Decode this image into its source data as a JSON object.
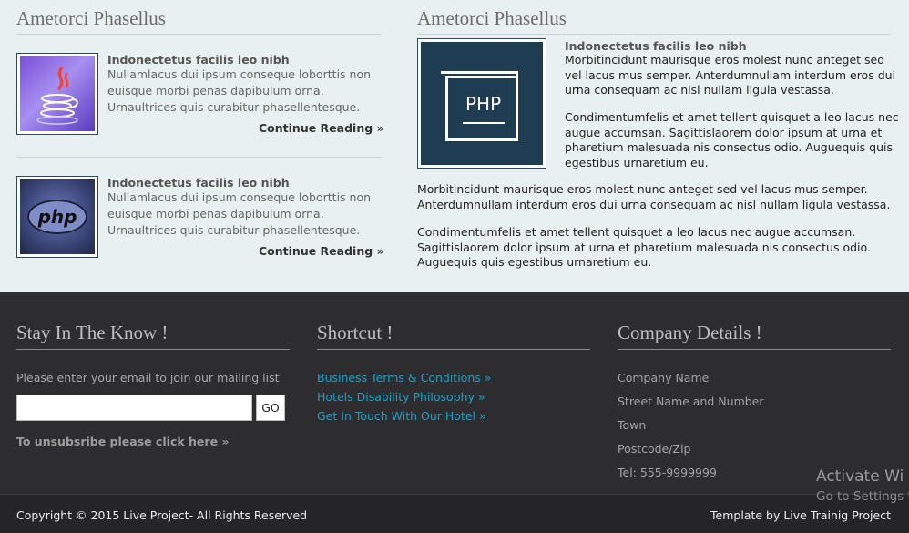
{
  "left": {
    "heading": "Ametorci Phasellus",
    "posts": [
      {
        "icon": "java-icon",
        "title": "Indonectetus facilis leo nibh",
        "lines": [
          "Nullamlacus dui ipsum conseque loborttis non",
          "euisque morbi penas dapibulum orna.",
          "Urnaultrices quis curabitur phasellentesque."
        ],
        "link": "Continue Reading »"
      },
      {
        "icon": "php-icon",
        "title": "Indonectetus facilis leo nibh",
        "lines": [
          "Nullamlacus dui ipsum conseque loborttis non",
          "euisque morbi penas dapibulum orna.",
          "Urnaultrices quis curabitur phasellentesque."
        ],
        "link": "Continue Reading »",
        "logo_text": "php"
      }
    ]
  },
  "right": {
    "heading": "Ametorci Phasellus",
    "image_label": "PHP",
    "title": "Indonectetus facilis leo nibh",
    "para1": [
      "Morbitincidunt maurisque eros molest nunc anteget sed",
      "vel lacus mus semper. Anterdumnullam interdum eros dui",
      "urna consequam ac nisl nullam ligula vestassa."
    ],
    "para2": [
      "Condimentumfelis et amet tellent quisquet a leo lacus nec",
      "augue accumsan. Sagittislaorem dolor ipsum at urna et",
      "pharetium malesuada nis consectus odio. Auguequis quis",
      "egestibus urnaretium eu."
    ],
    "para3": [
      "Morbitincidunt maurisque eros molest nunc anteget sed vel lacus mus semper.",
      "Anterdumnullam interdum eros dui urna consequam ac nisl nullam ligula vestassa."
    ],
    "para4": [
      "Condimentumfelis et amet tellent quisquet a leo lacus nec augue accumsan.",
      "Sagittislaorem dolor ipsum at urna et pharetium malesuada nis consectus odio.",
      "Auguequis quis egestibus urnaretium eu."
    ]
  },
  "footer": {
    "newsletter": {
      "heading": "Stay In The Know !",
      "prompt": "Please enter your email to join our mailing list",
      "email_value": "",
      "go_label": "GO",
      "unsubscribe": "To unsubsribe please click here »"
    },
    "shortcut": {
      "heading": "Shortcut !",
      "links": [
        "Business Terms & Conditions »",
        "Hotels Disability Philosophy »",
        "Get In Touch With Our Hotel »"
      ]
    },
    "company": {
      "heading": "Company Details !",
      "lines": [
        "Company Name",
        "Street Name and Number",
        "Town",
        "Postcode/Zip",
        "Tel: 555-9999999"
      ]
    }
  },
  "bottom": {
    "copyright": "Copyright © 2015 Live Project- All Rights Reserved",
    "template": "Template by Live Trainig Project"
  },
  "watermark": {
    "title": "Activate Wi",
    "subtitle": "Go to Settings t"
  },
  "colors": {
    "page_bg": "#e9f0f1",
    "footer_bg": "#2d2d2f",
    "link": "#1aa0c8",
    "php_tile": "#1f3d52"
  }
}
